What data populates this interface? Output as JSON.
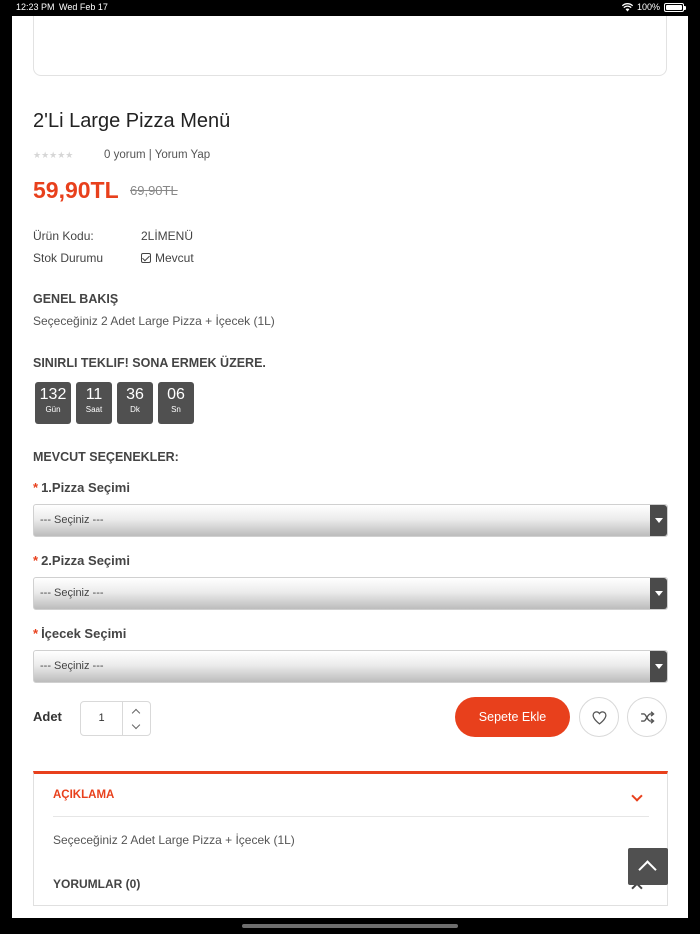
{
  "status_bar": {
    "time": "12:23 PM",
    "date": "Wed Feb 17",
    "battery": "100%"
  },
  "product": {
    "title": "2'Li Large Pizza Menü",
    "rating_stars": "★★★★★",
    "reviews": "0 yorum | Yorum Yap",
    "price": "59,90TL",
    "old_price": "69,90TL",
    "specs": [
      {
        "key": "Ürün Kodu:",
        "value": "2LİMENÜ"
      },
      {
        "key": "Stok Durumu",
        "value": "Mevcut"
      }
    ]
  },
  "overview": {
    "heading": "GENEL BAKIŞ",
    "text": "Seçeceğiniz 2 Adet Large Pizza + İçecek (1L)"
  },
  "offer": {
    "heading": "SINIRLI TEKLIF! SONA ERMEK ÜZERE.",
    "countdown": [
      {
        "value": "132",
        "unit": "Gün"
      },
      {
        "value": "11",
        "unit": "Saat"
      },
      {
        "value": "36",
        "unit": "Dk"
      },
      {
        "value": "06",
        "unit": "Sn"
      }
    ]
  },
  "options": {
    "heading": "MEVCUT SEÇENEKLER:",
    "items": [
      {
        "label": "1.Pizza Seçimi",
        "value": "--- Seçiniz ---"
      },
      {
        "label": "2.Pizza Seçimi",
        "value": "--- Seçiniz ---"
      },
      {
        "label": "İçecek Seçimi",
        "value": "--- Seçiniz ---"
      }
    ]
  },
  "purchase": {
    "qty_label": "Adet",
    "qty_value": "1",
    "add_to_cart": "Sepete Ekle"
  },
  "tabs": {
    "description_title": "AÇIKLAMA",
    "description_text": "Seçeceğiniz 2 Adet Large Pizza + İçecek (1L)",
    "reviews_title": "YORUMLAR (0)"
  },
  "colors": {
    "accent": "#e8401c",
    "dark": "#505050"
  },
  "icons": [
    "wifi-icon",
    "battery-icon",
    "star-icon",
    "check-square-icon",
    "heart-icon",
    "shuffle-icon",
    "chevron-down-icon",
    "chevron-up-icon",
    "scroll-top-icon"
  ]
}
